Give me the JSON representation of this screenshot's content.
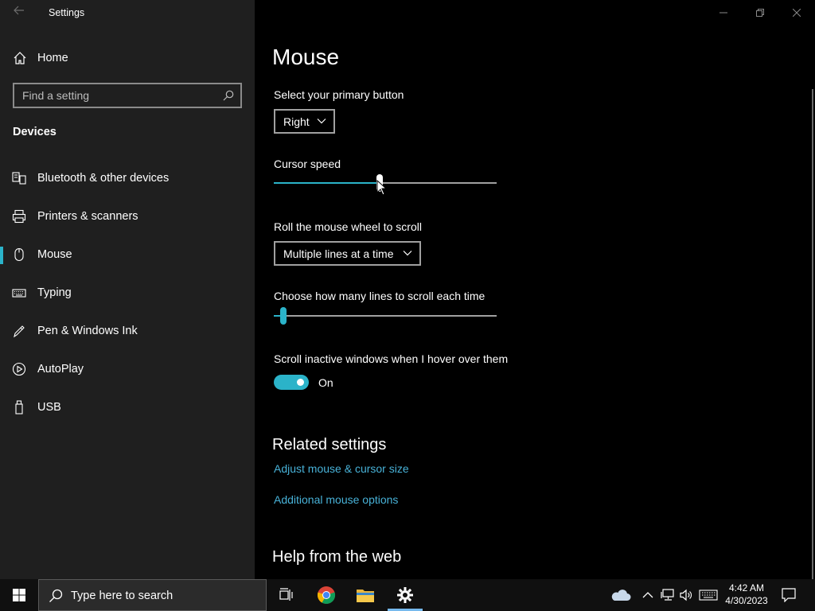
{
  "app": {
    "title": "Settings",
    "back_icon": "back-arrow-icon",
    "controls": {
      "minimize": "—",
      "maximize": "❐",
      "close": "✕"
    }
  },
  "sidebar": {
    "home_label": "Home",
    "search_placeholder": "Find a setting",
    "section_label": "Devices",
    "items": [
      {
        "label": "Bluetooth & other devices",
        "icon": "bluetooth-devices-icon"
      },
      {
        "label": "Printers & scanners",
        "icon": "printer-icon"
      },
      {
        "label": "Mouse",
        "icon": "mouse-icon",
        "selected": true
      },
      {
        "label": "Typing",
        "icon": "keyboard-icon"
      },
      {
        "label": "Pen & Windows Ink",
        "icon": "pen-icon"
      },
      {
        "label": "AutoPlay",
        "icon": "autoplay-icon"
      },
      {
        "label": "USB",
        "icon": "usb-icon"
      }
    ]
  },
  "main": {
    "title": "Mouse",
    "primary_button_label": "Select your primary button",
    "primary_button_value": "Right",
    "cursor_speed_label": "Cursor speed",
    "cursor_speed_fraction": 0.475,
    "wheel_label": "Roll the mouse wheel to scroll",
    "wheel_value": "Multiple lines at a time",
    "lines_label": "Choose how many lines to scroll each time",
    "lines_fraction": 0.03,
    "inactive_label": "Scroll inactive windows when I hover over them",
    "inactive_toggle": "On",
    "related_heading": "Related settings",
    "link_cursor_size": "Adjust mouse & cursor size",
    "link_additional": "Additional mouse options",
    "help_heading": "Help from the web"
  },
  "taskbar": {
    "search_placeholder": "Type here to search",
    "time": "4:42 AM",
    "date": "4/30/2023",
    "pinned": [
      "task-view-icon",
      "chrome-icon",
      "file-explorer-icon",
      "settings-gear-icon"
    ],
    "tray": [
      "onedrive-cloud-icon",
      "chevron-up-icon",
      "network-icon",
      "volume-icon",
      "keyboard-icon",
      "notification-icon"
    ]
  },
  "colors": {
    "accent": "#2bb3c9",
    "link": "#48b2d8",
    "sidebar_bg": "#1f1f1f"
  }
}
